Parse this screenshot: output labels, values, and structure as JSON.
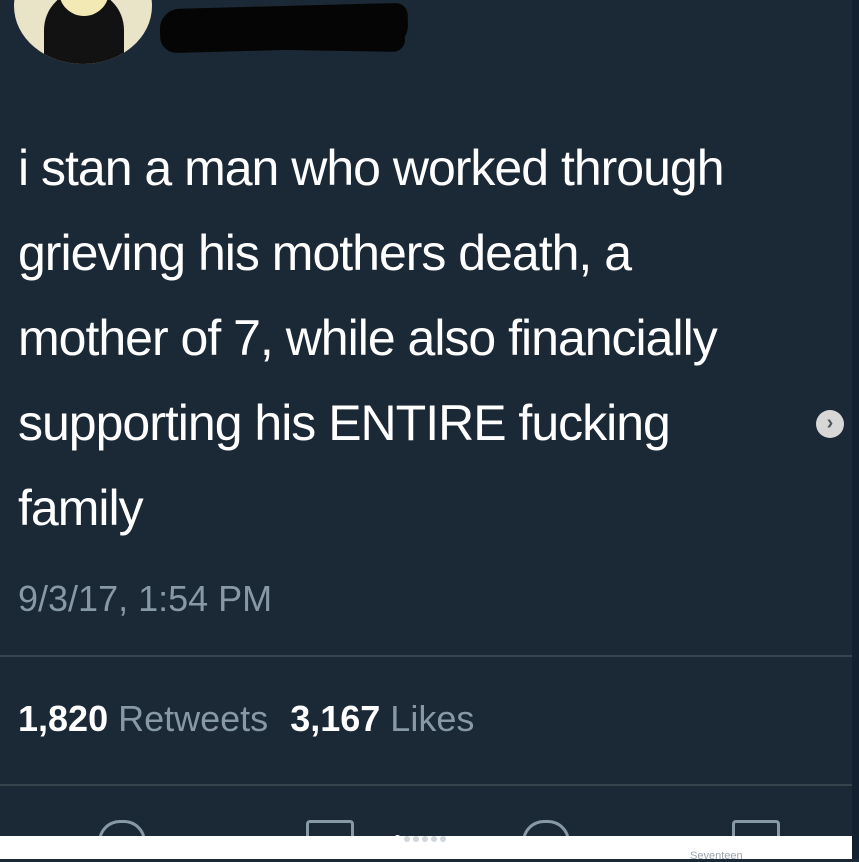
{
  "tweet": {
    "text": "i stan a man who worked through\ngrieving his mothers death, a\nmother of 7, while also financially\nsupporting his ENTIRE fucking\nfamily",
    "timestamp": "9/3/17, 1:54 PM"
  },
  "stats": {
    "retweets_count": "1,820",
    "retweets_label": "Retweets",
    "likes_count": "3,167",
    "likes_label": "Likes"
  },
  "carousel": {
    "next_glyph": "›",
    "dot_count": 6,
    "active_index": 0
  },
  "icons": {
    "reply": "reply-icon",
    "retweet": "retweet-icon",
    "like": "heart-icon",
    "share": "share-icon",
    "next": "chevron-right-icon"
  },
  "watermark": {
    "text": "Seventeen"
  },
  "colors": {
    "background": "#1b2836",
    "text": "#ffffff",
    "muted": "#8899a6",
    "divider": "#38444d"
  }
}
